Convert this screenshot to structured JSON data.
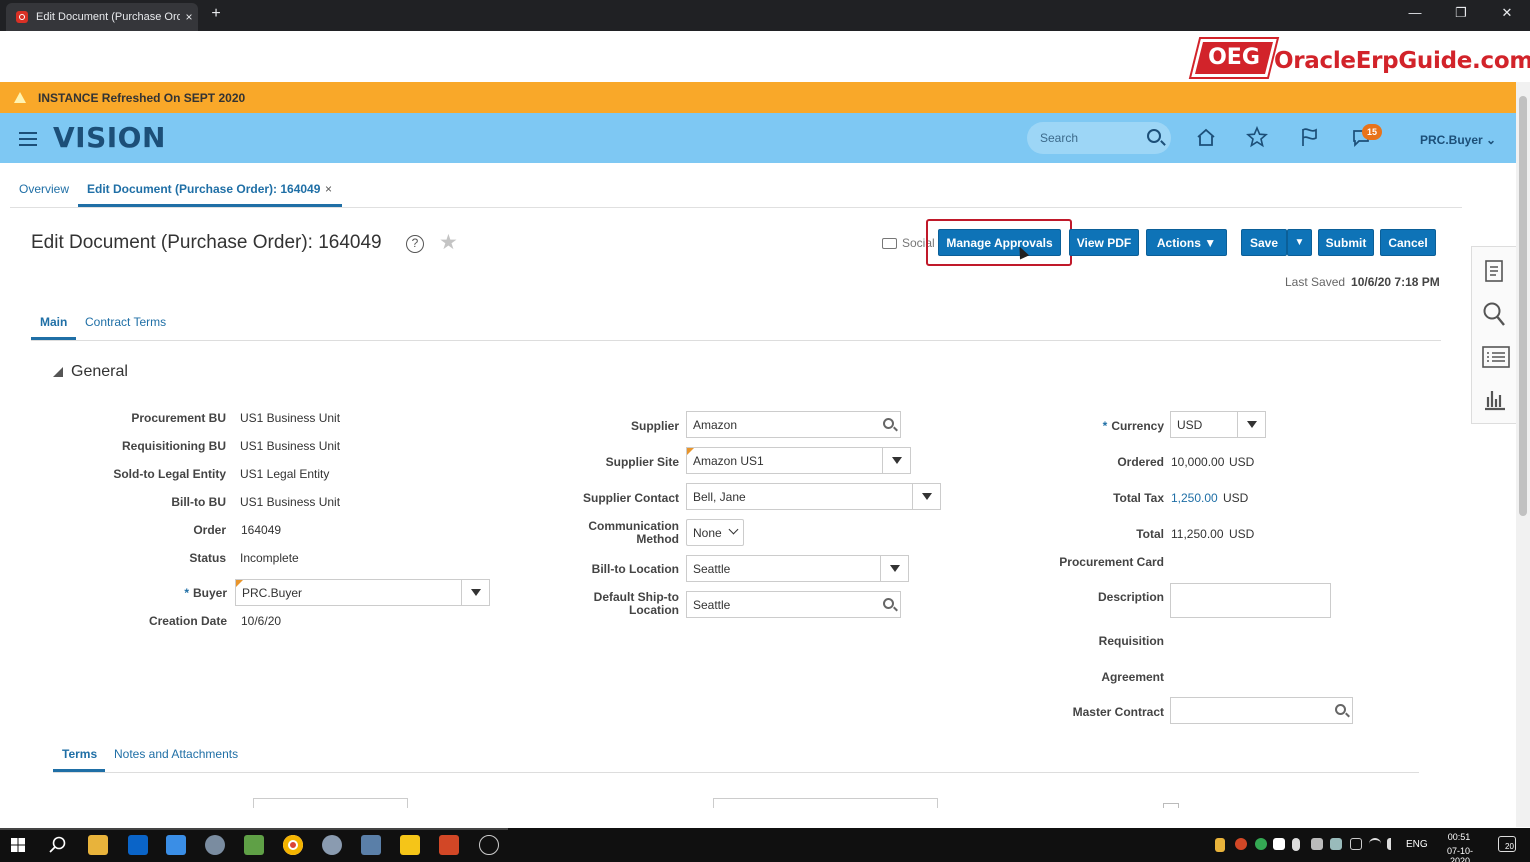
{
  "browser": {
    "tab_title": "Edit Document (Purchase Order)",
    "new_tab": "+",
    "tab_close": "×",
    "minimize": "—",
    "restore": "❐",
    "close": "✕"
  },
  "brand": {
    "badge": "OEG",
    "name": "OracleErpGuide.com"
  },
  "banner": {
    "text": "INSTANCE Refreshed On SEPT 2020"
  },
  "header": {
    "app_name": "VISION",
    "search_placeholder": "Search",
    "notification_count": "15",
    "user": "PRC.Buyer ⌄"
  },
  "page_tabs": {
    "overview": "Overview",
    "current": "Edit Document (Purchase Order): 164049",
    "close": "×"
  },
  "title": {
    "text": "Edit Document (Purchase Order): 164049",
    "help": "?",
    "star": "★"
  },
  "toolbar": {
    "social": "Social",
    "manage_approvals": "Manage Approvals",
    "view_pdf": "View PDF",
    "actions": "Actions ▼",
    "save": "Save",
    "save_menu": "▼",
    "submit": "Submit",
    "cancel": "Cancel"
  },
  "last_saved": {
    "label": "Last Saved",
    "value": "10/6/20 7:18 PM"
  },
  "sub_tabs": {
    "main": "Main",
    "contract_terms": "Contract Terms"
  },
  "general": {
    "title": "General",
    "left": [
      {
        "label": "Procurement BU",
        "value": "US1 Business Unit"
      },
      {
        "label": "Requisitioning BU",
        "value": "US1 Business Unit"
      },
      {
        "label": "Sold-to Legal Entity",
        "value": "US1 Legal Entity"
      },
      {
        "label": "Bill-to BU",
        "value": "US1 Business Unit"
      },
      {
        "label": "Order",
        "value": "164049"
      },
      {
        "label": "Status",
        "value": "Incomplete"
      }
    ],
    "buyer_label": "Buyer",
    "buyer_value": "PRC.Buyer",
    "creation_date_label": "Creation Date",
    "creation_date_value": "10/6/20",
    "supplier_label": "Supplier",
    "supplier_value": "Amazon",
    "supplier_site_label": "Supplier Site",
    "supplier_site_value": "Amazon US1",
    "supplier_contact_label": "Supplier Contact",
    "supplier_contact_value": "Bell, Jane",
    "comm_method_label_1": "Communication",
    "comm_method_label_2": "Method",
    "comm_method_value": "None",
    "bill_to_location_label": "Bill-to Location",
    "bill_to_location_value": "Seattle",
    "ship_to_label_1": "Default Ship-to",
    "ship_to_label_2": "Location",
    "ship_to_value": "Seattle",
    "currency_label": "Currency",
    "currency_value": "USD",
    "ordered_label": "Ordered",
    "ordered_value": "10,000.00",
    "ordered_currency": "USD",
    "total_tax_label": "Total Tax",
    "total_tax_value": "1,250.00",
    "total_tax_currency": "USD",
    "total_label": "Total",
    "total_value": "11,250.00",
    "total_currency": "USD",
    "procurement_card_label": "Procurement Card",
    "description_label": "Description",
    "requisition_label": "Requisition",
    "agreement_label": "Agreement",
    "master_contract_label": "Master Contract"
  },
  "bottom_tabs": {
    "terms": "Terms",
    "notes": "Notes and Attachments"
  },
  "taskbar": {
    "lang": "ENG",
    "time": "00:51",
    "date": "07-10-2020",
    "notif": "20"
  },
  "colors": {
    "accent": "#0e73b7",
    "banner": "#f9a829",
    "header": "#7ec8f3",
    "highlight": "#c0192a"
  }
}
